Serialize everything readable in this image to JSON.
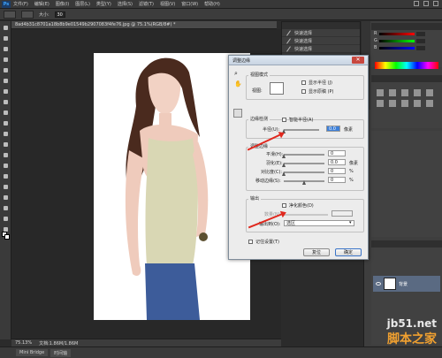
{
  "menubar": {
    "logo": "Ps",
    "items": [
      "文件(F)",
      "编辑(E)",
      "图像(I)",
      "图层(L)",
      "类型(Y)",
      "选择(S)",
      "滤镜(T)",
      "视图(V)",
      "窗口(W)",
      "帮助(H)"
    ]
  },
  "options": {
    "size_label": "大小:",
    "size_value": "30"
  },
  "document": {
    "tab_title": "8ad4b31c8701a18b8b9e01549b2907083f4fe76.jpg @ 75.1%(RGB/8#) *",
    "zoom": "75.13%",
    "doc_info": "文档:1.86M/1.86M"
  },
  "history": {
    "items": [
      "快速选择",
      "快速选择",
      "快速选择"
    ]
  },
  "dialog": {
    "title": "调整边缘",
    "view_mode_label": "视图模式",
    "view_label": "视图:",
    "show_radius": "显示半径 (J)",
    "show_original": "显示原稿 (P)",
    "edge_detection_label": "边缘检测",
    "smart_radius": "智能半径(A)",
    "radius_label": "半径(U):",
    "radius_value": "0.0",
    "radius_unit": "像素",
    "adjust_edge_label": "调整边缘",
    "smooth_label": "平滑(H):",
    "smooth_value": "0",
    "feather_label": "羽化(E):",
    "feather_value": "0.0",
    "feather_unit": "像素",
    "contrast_label": "对比度(C):",
    "contrast_value": "0",
    "contrast_unit": "%",
    "shift_edge_label": "移动边缘(S):",
    "shift_edge_value": "0",
    "shift_edge_unit": "%",
    "output_label": "输出",
    "decontaminate": "净化颜色(D)",
    "amount_label": "数量(N):",
    "output_to_label": "输出到(O):",
    "output_to_value": "选区",
    "remember": "记住设置(T)",
    "cancel": "复位",
    "ok": "确定"
  },
  "layers": {
    "layer_name": "背景"
  },
  "bottom_tabs": [
    "Mini Bridge",
    "时间轴"
  ],
  "watermark": {
    "url": "jb51.net",
    "name": "脚本之家"
  }
}
